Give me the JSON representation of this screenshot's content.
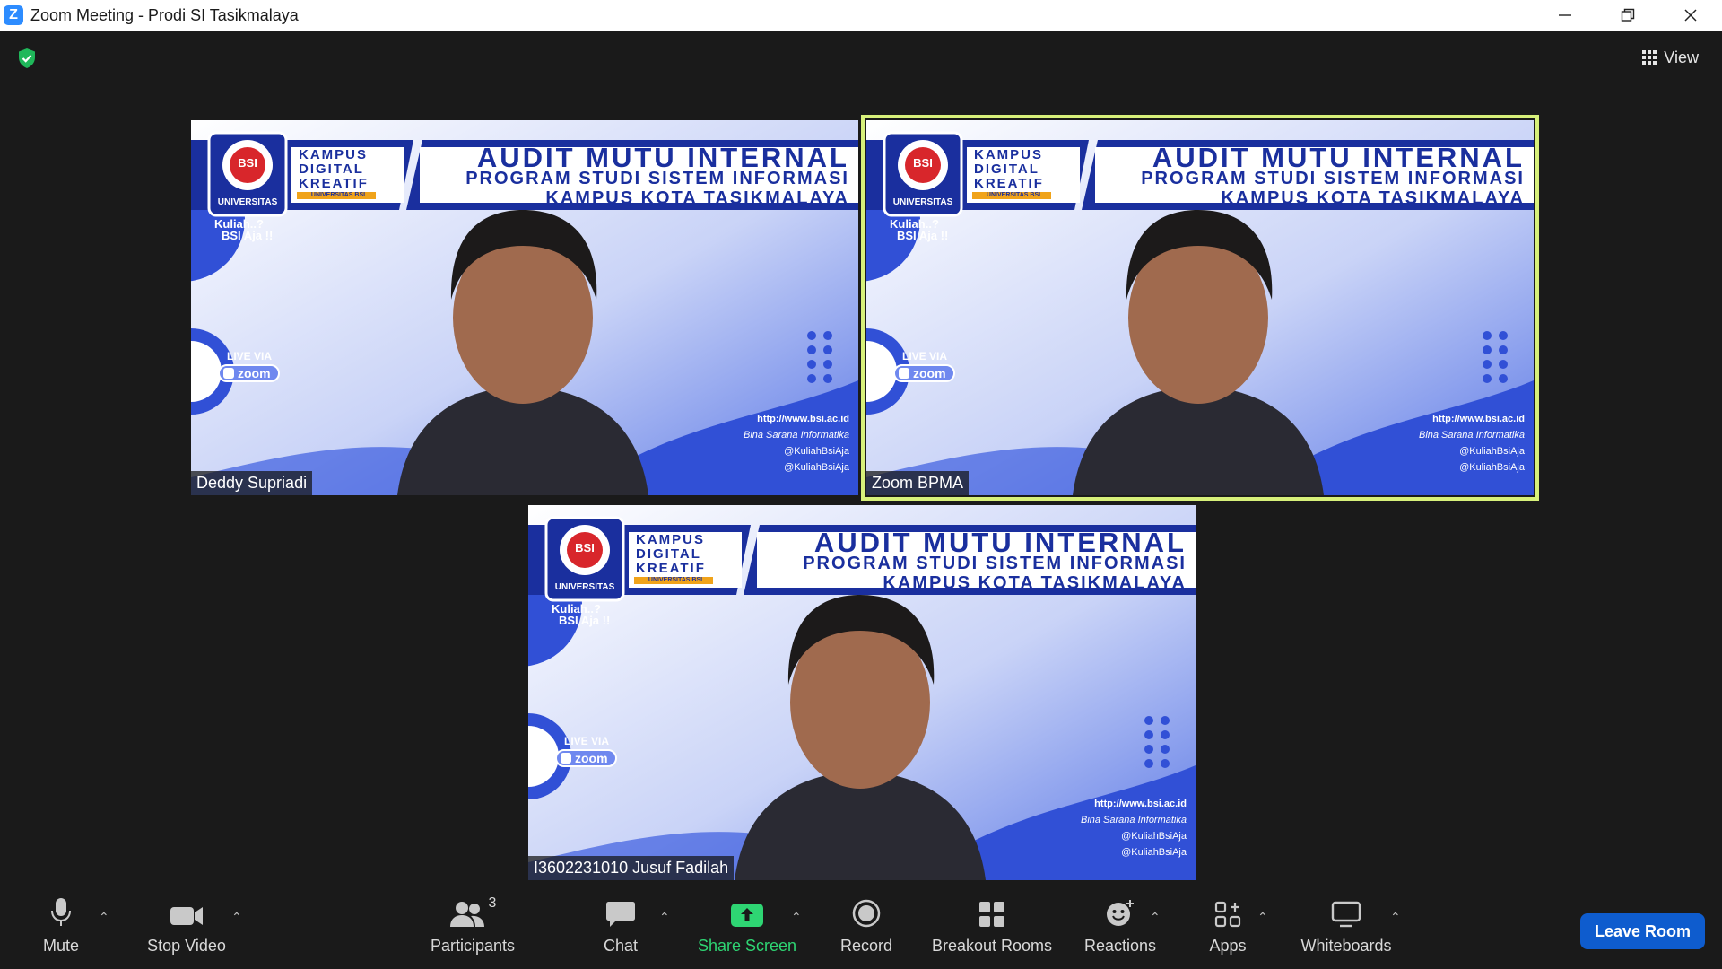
{
  "window": {
    "app_logo": "Z",
    "title": "Zoom Meeting - Prodi SI Tasikmalaya",
    "controls": [
      "minimize-icon",
      "restore-icon",
      "close-icon"
    ]
  },
  "top": {
    "encryption_icon": "shield-check-icon",
    "view_label": "View"
  },
  "participants": [
    {
      "name": "Deddy Supriadi",
      "active_speaker": false
    },
    {
      "name": "Zoom BPMA",
      "active_speaker": true
    },
    {
      "name": "I3602231010 Jusuf Fadilah",
      "active_speaker": false
    }
  ],
  "background": {
    "badge_line1": "KAMPUS",
    "badge_line2": "DIGITAL",
    "badge_line3": "KREATIF",
    "badge_sub": "UNIVERSITAS BSI",
    "logo_text": "UNIVERSITAS",
    "logo_letters": "BSI",
    "tagline1": "Kuliah..?",
    "tagline2": "BSI Aja !!",
    "heading1": "AUDIT MUTU INTERNAL",
    "heading2": "PROGRAM STUDI SISTEM INFORMASI",
    "heading3": "KAMPUS KOTA TASIKMALAYA",
    "live_via": "LIVE VIA",
    "zoom_word": "zoom",
    "web": "http://www.bsi.ac.id",
    "facebook": "Bina Sarana Informatika",
    "twitter": "@KuliahBsiAja",
    "instagram": "@KuliahBsiAja"
  },
  "toolbar": {
    "mute": "Mute",
    "stop_video": "Stop Video",
    "participants": "Participants",
    "participants_count": "3",
    "chat": "Chat",
    "share_screen": "Share Screen",
    "record": "Record",
    "breakout_rooms": "Breakout Rooms",
    "reactions": "Reactions",
    "apps": "Apps",
    "whiteboards": "Whiteboards",
    "leave": "Leave Room"
  },
  "colors": {
    "share_green": "#2ed573",
    "leave_blue": "#0e5cce",
    "active_border": "#d7f07a",
    "banner_blue": "#1a2f9e"
  }
}
